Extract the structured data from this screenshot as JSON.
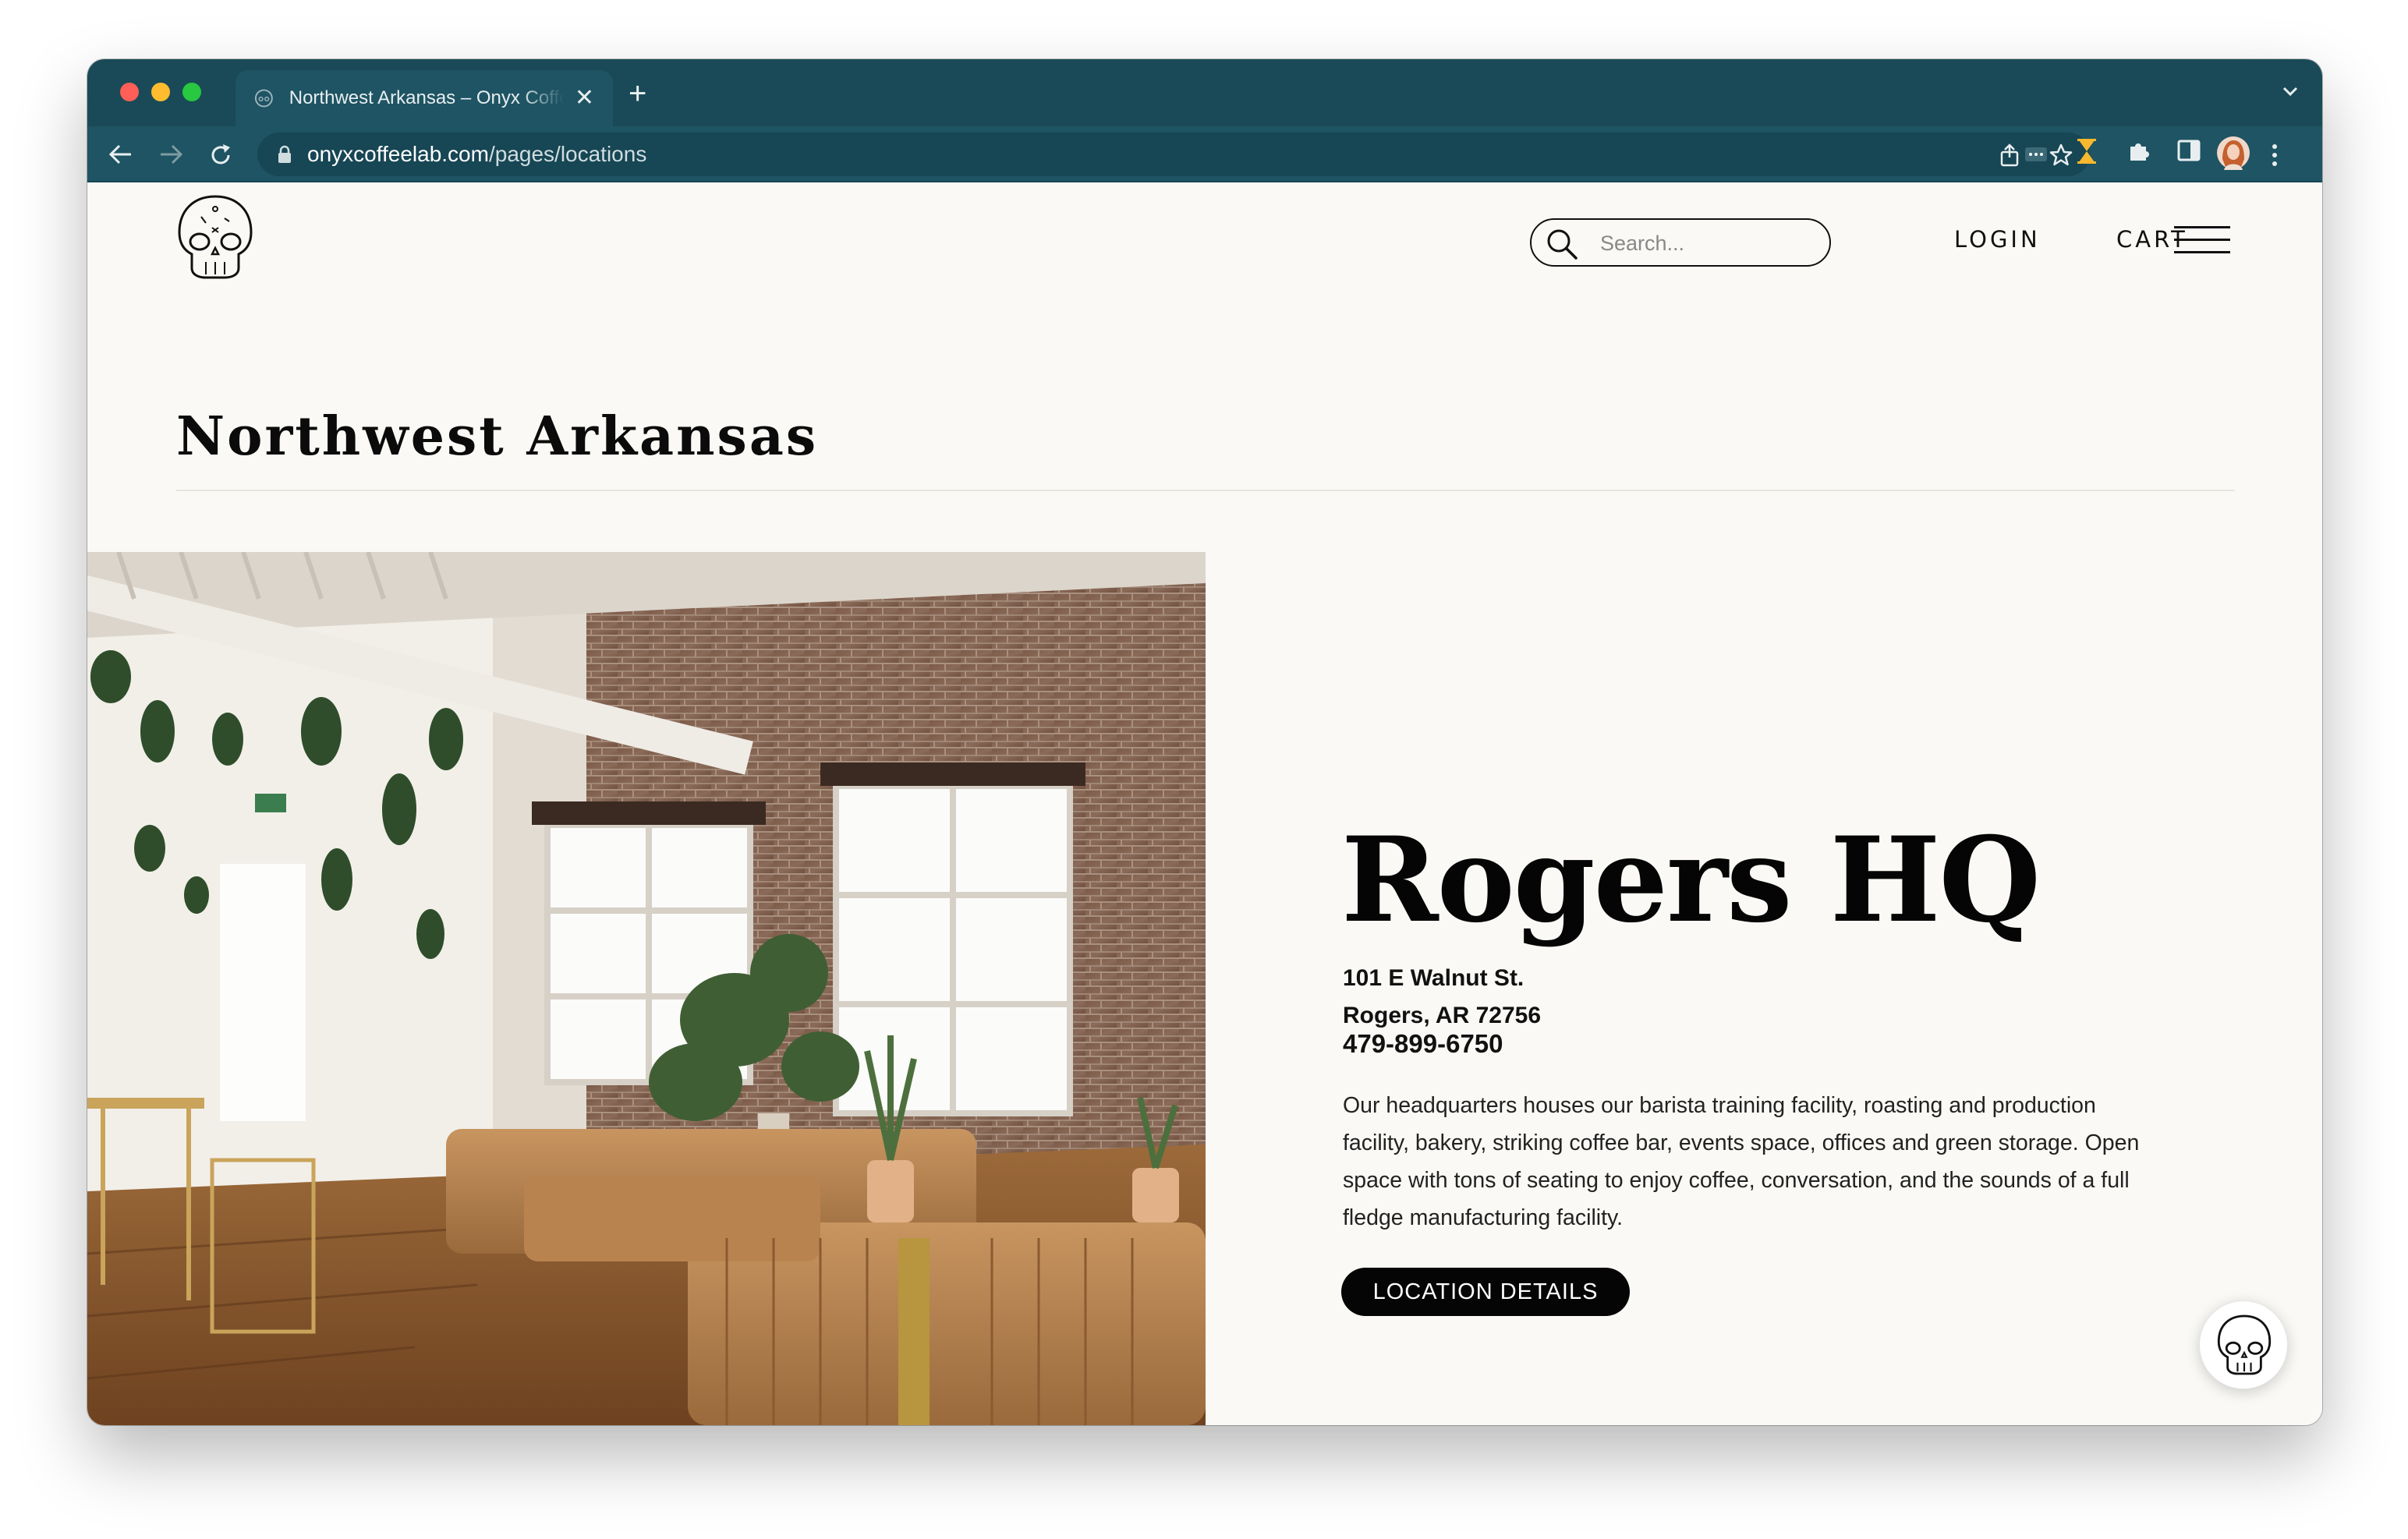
{
  "browser": {
    "tab_title": "Northwest Arkansas – Onyx Coffee Lab",
    "tab_close_glyph": "✕",
    "new_tab_glyph": "+",
    "url_host": "onyxcoffeelab.com",
    "url_path": "/pages/locations"
  },
  "header": {
    "search_placeholder": "Search...",
    "login_label": "LOGIN",
    "cart_label": "CART"
  },
  "region": {
    "title": "Northwest Arkansas"
  },
  "location": {
    "name": "Rogers HQ",
    "address_line1": "101 E Walnut St.",
    "address_line2": "Rogers, AR 72756",
    "phone": "479-899-6750",
    "description": "Our headquarters houses our barista training facility, roasting and production facility, bakery, striking coffee bar, events space, offices and green storage. Open space with tons of seating to enjoy coffee, conversation, and the sounds of a full fledge manufacturing facility.",
    "button_label": "LOCATION DETAILS"
  },
  "colors": {
    "chrome_dark": "#1a4a57",
    "chrome_toolbar": "#1e5463",
    "page_bg": "#faf9f5",
    "text": "#111111"
  },
  "icons": [
    "skull-logo-icon",
    "search-icon",
    "hamburger-menu-icon",
    "back-icon",
    "forward-icon",
    "reload-icon",
    "lock-icon",
    "share-icon",
    "star-icon",
    "extension-icon",
    "sidebar-icon",
    "profile-avatar",
    "kebab-menu-icon"
  ]
}
